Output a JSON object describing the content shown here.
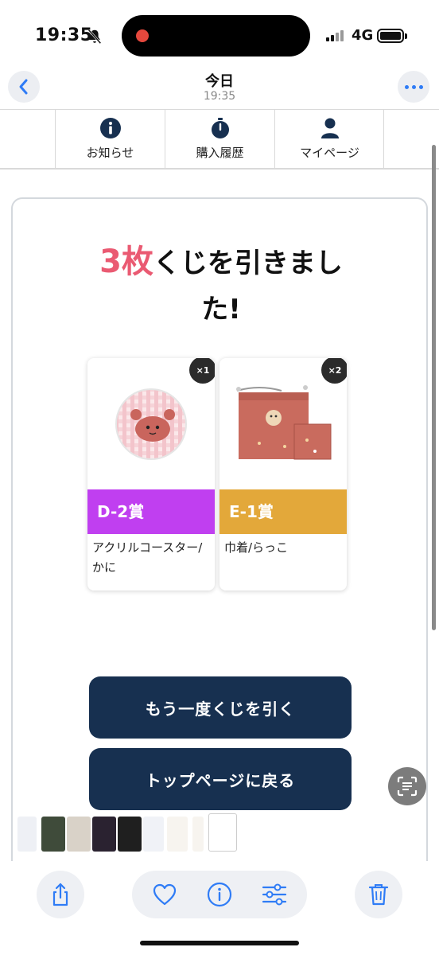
{
  "status_bar": {
    "time": "19:35",
    "network": "4G"
  },
  "nav": {
    "title": "今日",
    "subtitle": "19:35"
  },
  "site_tabs": [
    {
      "label": "お知らせ",
      "icon": "info-circle-icon"
    },
    {
      "label": "購入履歴",
      "icon": "stopwatch-icon"
    },
    {
      "label": "マイページ",
      "icon": "person-icon"
    }
  ],
  "result": {
    "count": "3枚",
    "headline_line1": "くじを引きまし",
    "headline_line2": "た!"
  },
  "prizes": [
    {
      "quantity": "×1",
      "rank": "D-2賞",
      "name": "アクリルコースター/かに",
      "rank_color": "#c03ff0"
    },
    {
      "quantity": "×2",
      "rank": "E-1賞",
      "name": "巾着/らっこ",
      "rank_color": "#e3a83a"
    }
  ],
  "buttons": {
    "draw_again": "もう一度くじを引く",
    "back_top": "トップページに戻る"
  },
  "colors": {
    "accent_count": "#ea5a72",
    "button_bg": "#173050",
    "ios_blue": "#2f7cf6"
  },
  "toolbar": {
    "icons": [
      "share-icon",
      "heart-icon",
      "info-icon",
      "adjust-icon",
      "trash-icon"
    ]
  }
}
